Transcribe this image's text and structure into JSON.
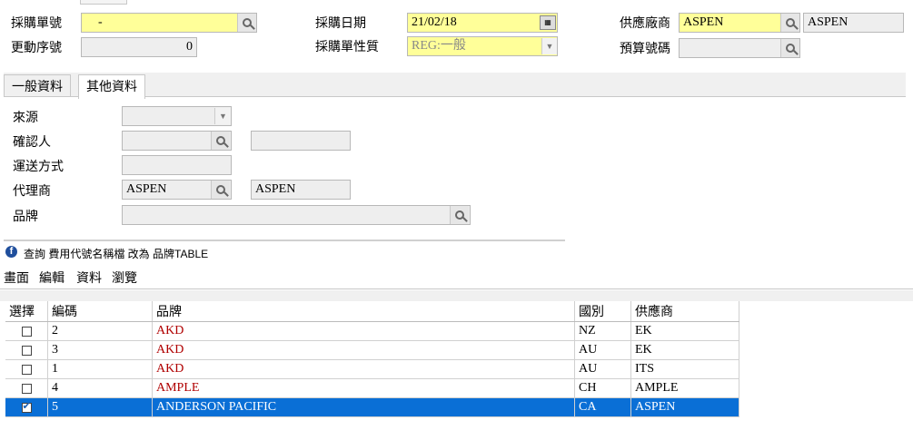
{
  "header": {
    "po_number_label": "採購單號",
    "po_number_value": "-",
    "revision_label": "更動序號",
    "revision_value": "0",
    "po_date_label": "採購日期",
    "po_date_value": "21/02/18",
    "po_type_label": "採購單性質",
    "po_type_value": "REG:一般",
    "supplier_label": "供應廠商",
    "supplier_code": "ASPEN",
    "supplier_name": "ASPEN",
    "budget_label": "預算號碼",
    "budget_value": ""
  },
  "tabs": [
    {
      "label": "一般資料",
      "active": false
    },
    {
      "label": "其他資料",
      "active": true
    }
  ],
  "other": {
    "source_label": "來源",
    "source_value": "",
    "confirmer_label": "確認人",
    "confirmer_code": "",
    "confirmer_name": "",
    "shipping_label": "運送方式",
    "shipping_value": "",
    "agent_label": "代理商",
    "agent_code": "ASPEN",
    "agent_name": "ASPEN",
    "brand_label": "品牌",
    "brand_value": ""
  },
  "lookup": {
    "title": "查詢 費用代號名稱檔 改為 品牌TABLE",
    "menu": [
      "畫面",
      "編輯",
      "資料",
      "瀏覽"
    ],
    "columns": [
      "選擇",
      "編碼",
      "品牌",
      "國別",
      "供應商"
    ],
    "rows": [
      {
        "checked": false,
        "code": "2",
        "brand": "AKD",
        "country": "NZ",
        "supplier": "EK"
      },
      {
        "checked": false,
        "code": "3",
        "brand": "AKD",
        "country": "AU",
        "supplier": "EK"
      },
      {
        "checked": false,
        "code": "1",
        "brand": "AKD",
        "country": "AU",
        "supplier": "ITS"
      },
      {
        "checked": false,
        "code": "4",
        "brand": "AMPLE",
        "country": "CH",
        "supplier": "AMPLE"
      },
      {
        "checked": true,
        "code": "5",
        "brand": "ANDERSON PACIFIC",
        "country": "CA",
        "supplier": "ASPEN",
        "selected": true
      }
    ]
  },
  "colors": {
    "required_field": "#ffff99",
    "readonly_field": "#eeeeee",
    "selection": "#0a6fd6",
    "brand_text": "#b00000"
  }
}
